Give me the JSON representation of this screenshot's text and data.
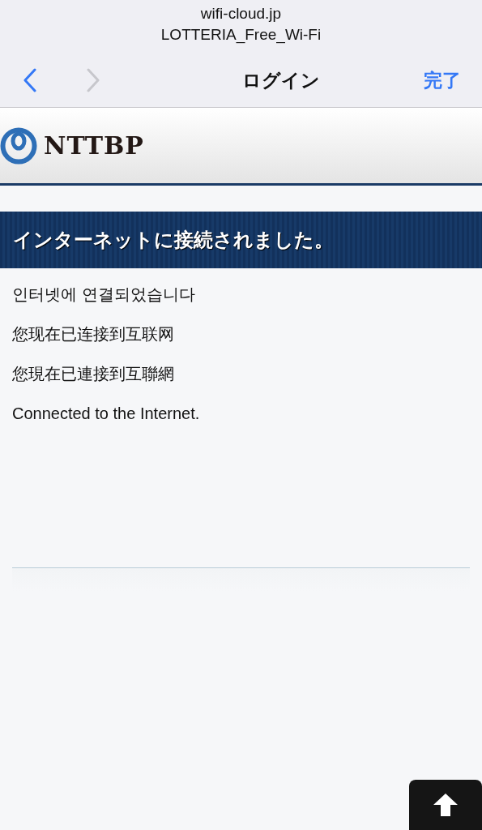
{
  "browser": {
    "domain": "wifi-cloud.jp",
    "network": "LOTTERIA_Free_Wi-Fi"
  },
  "navigation": {
    "back": {
      "disabled": false
    },
    "forward": {
      "disabled": true
    },
    "title": "ログイン",
    "done": "完了"
  },
  "header": {
    "logo_text": "NTTBP"
  },
  "banner": "インターネットに接続されました。",
  "messages": [
    "인터넷에 연결되었습니다",
    "您现在已连接到互联网",
    "您現在已連接到互聯網",
    "Connected to the Internet."
  ],
  "scroll_top": {
    "kind": "arrow"
  }
}
